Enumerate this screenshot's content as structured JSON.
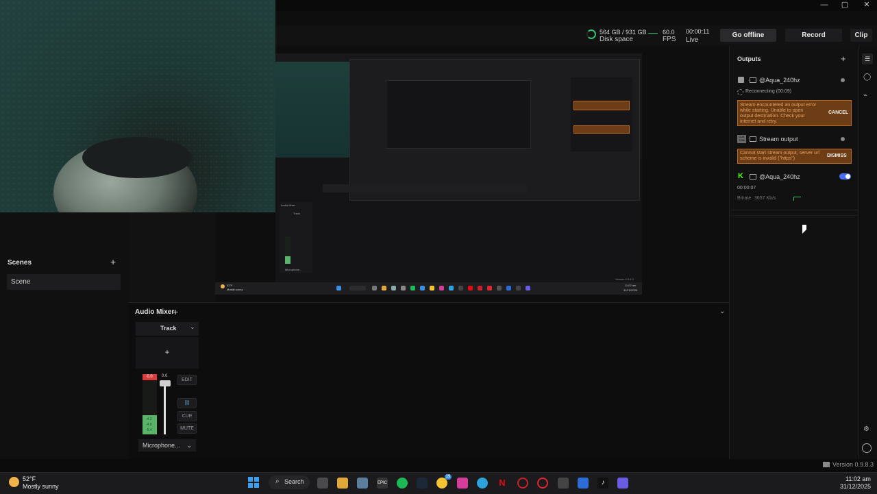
{
  "window": {
    "minimize": "—",
    "maximize": "▢",
    "close": "✕"
  },
  "topbar": {
    "disk_used": "564 GB / 931 GB",
    "disk_label": "Disk space",
    "fps_value": "60.0",
    "fps_label": "FPS",
    "time": "00:00:11",
    "time_label": "Live",
    "go_offline": "Go offline",
    "record": "Record",
    "clip": "Clip"
  },
  "scenes": {
    "title": "Scenes",
    "add": "+",
    "items": [
      "Scene"
    ]
  },
  "mixer": {
    "title": "Audio Mixer",
    "add": "+",
    "track": "Track",
    "add_source": "+",
    "peak": "0.0",
    "fader_value": "0.0",
    "meter_labels": [
      "-4.2",
      "-4.8",
      "-5.4"
    ],
    "edit": "EDIT",
    "cue": "CUE",
    "mute": "MUTE",
    "device": "Microphone..."
  },
  "outputs": {
    "title": "Outputs",
    "add": "+",
    "items": [
      {
        "name": "@Aqua_240hz",
        "status": "Reconnecting (00:09)",
        "error": "Stream encountered an output error while starting. Unable to open output destination. Check your internet and retry.",
        "error_action": "CANCEL"
      },
      {
        "name": "Stream output",
        "logo": "CUS TOM",
        "error": "Cannot start stream output, server url scheme is invalid (\"https\")",
        "error_action": "DISMISS"
      },
      {
        "name": "@Aqua_240hz",
        "time": "00:00:07",
        "bitrate_label": "Bitrate",
        "bitrate_value": "3657 Kb/s"
      }
    ]
  },
  "footer": {
    "version": "Version 0.9.8.3"
  },
  "taskbar": {
    "weather_temp": "52°F",
    "weather_desc": "Mostly sunny",
    "search": "Search",
    "time": "11:02 am",
    "date": "31/12/2025",
    "badge": "19"
  },
  "preview": {
    "mini_time": "11:02 am",
    "mini_date": "31/12/2025",
    "mini_weather": "52°F",
    "mini_weather_desc": "Mostly sunny",
    "mini_version": "Version 0.9.8.3",
    "mini_mixer_title": "Audio Mixer",
    "mini_track": "Track",
    "mini_device": "Microphone..."
  },
  "colors": {
    "accent_blue": "#4a6cf7",
    "error_orange": "#b86a22",
    "meter_green": "#5ab56a",
    "peak_red": "#d93c3c"
  }
}
